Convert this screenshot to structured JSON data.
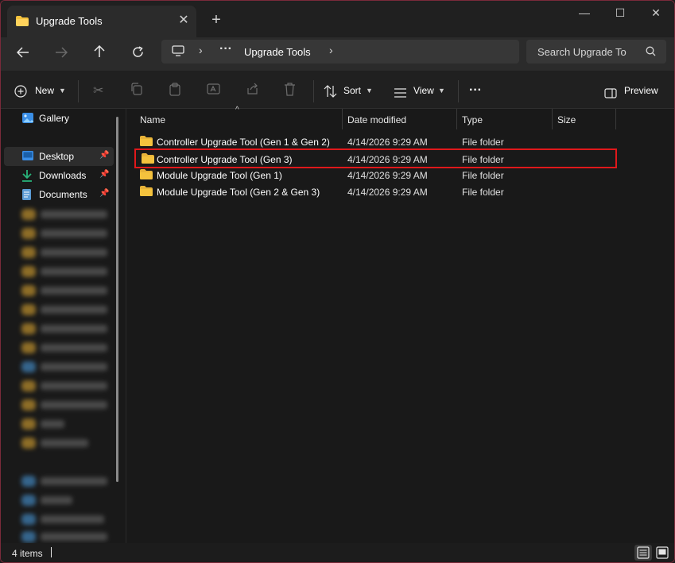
{
  "window": {
    "tab_title": "Upgrade Tools",
    "new_tab_symbol": "+",
    "close_tab_symbol": "✕",
    "minimize_symbol": "—",
    "maximize_symbol": "☐",
    "close_symbol": "✕"
  },
  "address_bar": {
    "path_separator": "›",
    "overflow": "···",
    "current_folder": "Upgrade Tools",
    "search_placeholder": "Search Upgrade To"
  },
  "command_bar": {
    "new_label": "New",
    "sort_label": "Sort",
    "view_label": "View",
    "more_label": "···",
    "preview_label": "Preview"
  },
  "sidebar": {
    "gallery": "Gallery",
    "pinned": [
      {
        "label": "Desktop",
        "icon": "desktop-icon"
      },
      {
        "label": "Downloads",
        "icon": "download-icon"
      },
      {
        "label": "Documents",
        "icon": "documents-icon"
      }
    ]
  },
  "columns": {
    "name": "Name",
    "date": "Date modified",
    "type": "Type",
    "size": "Size"
  },
  "files": [
    {
      "name": "Controller Upgrade Tool (Gen 1 & Gen 2)",
      "date": "4/14/2026 9:29 AM",
      "type": "File folder",
      "size": ""
    },
    {
      "name": "Controller Upgrade Tool (Gen 3)",
      "date": "4/14/2026 9:29 AM",
      "type": "File folder",
      "size": ""
    },
    {
      "name": "Module Upgrade Tool (Gen 1)",
      "date": "4/14/2026 9:29 AM",
      "type": "File folder",
      "size": ""
    },
    {
      "name": "Module Upgrade Tool (Gen 2 & Gen 3)",
      "date": "4/14/2026 9:29 AM",
      "type": "File folder",
      "size": ""
    }
  ],
  "status": {
    "item_count": "4 items"
  },
  "colors": {
    "highlight_border": "#e0181b",
    "folder_yellow": "#f4c23d",
    "accent_blue": "#4cc2ff"
  }
}
